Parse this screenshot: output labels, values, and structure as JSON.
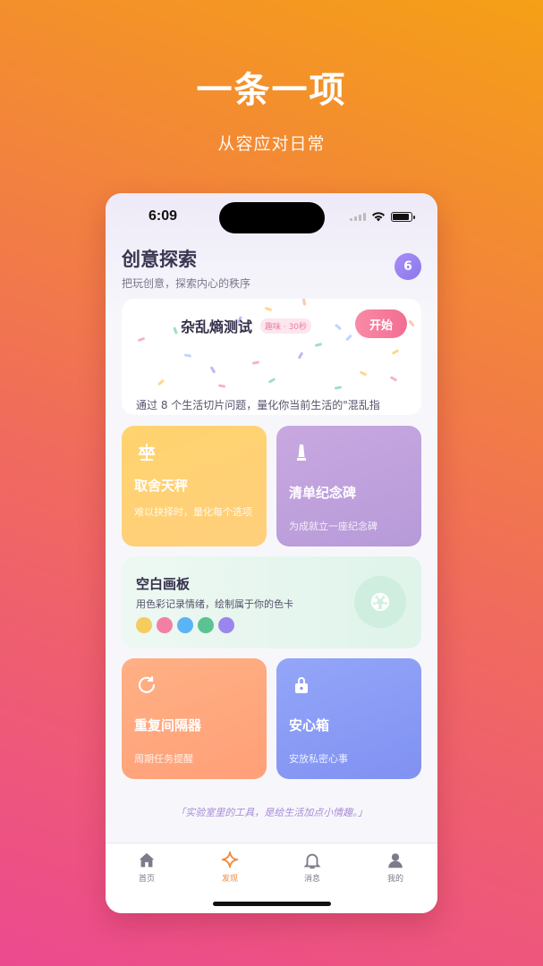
{
  "hero": {
    "title": "一条一项",
    "subtitle": "从容应对日常"
  },
  "status_bar": {
    "time": "6:09",
    "battery_level": 0.9
  },
  "header": {
    "title": "创意探索",
    "subtitle": "把玩创意，探索内心的秩序",
    "badge_count": "6"
  },
  "entropy_card": {
    "title": "杂乱熵测试",
    "tag": "趣味 · 30秒",
    "button_label": "开始",
    "description": "通过 8 个生活切片问题，量化你当前生活的\"混乱指"
  },
  "tiles": {
    "scale": {
      "title": "取舍天秤",
      "description": "难以抉择时，量化每个选项",
      "icon": "scale-icon"
    },
    "monument": {
      "title": "清单纪念碑",
      "description": "为成就立一座纪念碑",
      "icon": "monument-icon"
    },
    "canvas": {
      "title": "空白画板",
      "description": "用色彩记录情绪，绘制属于你的色卡",
      "icon": "palette-icon",
      "swatch_colors": [
        "#f5cd5e",
        "#f47fa5",
        "#5bb4f5",
        "#5cc293",
        "#9b86ee"
      ]
    },
    "repeat": {
      "title": "重复间隔器",
      "description": "周期任务提醒",
      "icon": "refresh-icon"
    },
    "safe": {
      "title": "安心箱",
      "description": "安放私密心事",
      "icon": "lock-icon"
    }
  },
  "quote": "「实验室里的工具，是给生活加点小情趣。」",
  "tabbar": {
    "tabs": [
      {
        "label": "首页",
        "icon": "home-icon",
        "active": false
      },
      {
        "label": "发现",
        "icon": "sparkle-icon",
        "active": true
      },
      {
        "label": "消息",
        "icon": "bell-icon",
        "active": false
      },
      {
        "label": "我的",
        "icon": "user-icon",
        "active": false
      }
    ]
  },
  "colors": {
    "accent": "#f08a3c",
    "badge": "#8a79ee",
    "start_button": "#f36d92"
  }
}
